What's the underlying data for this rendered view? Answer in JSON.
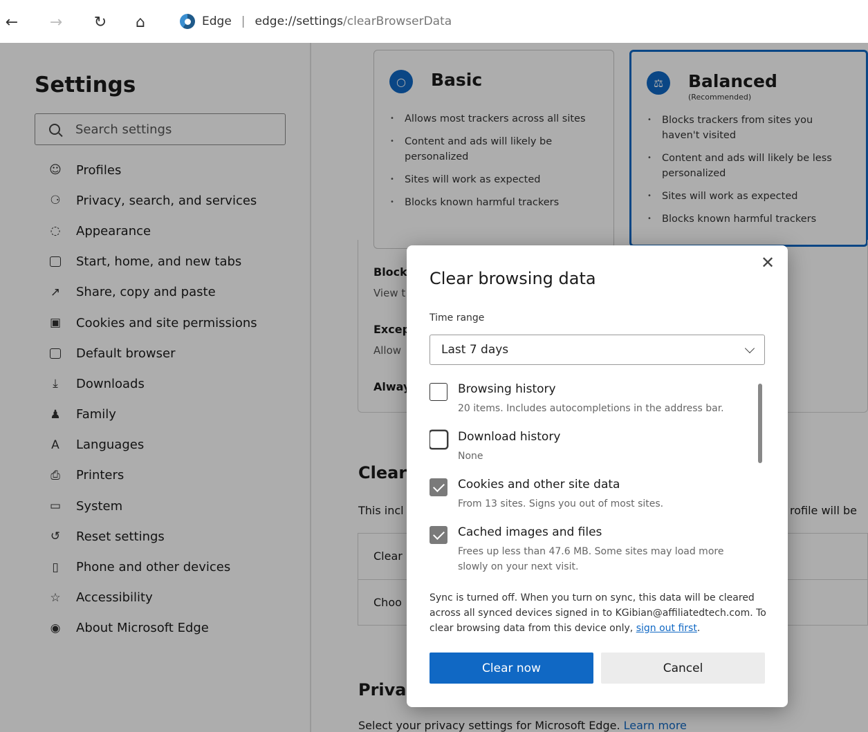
{
  "toolbar": {
    "site_label": "Edge",
    "url_host": "edge://settings",
    "url_path": "/clearBrowserData"
  },
  "sidebar": {
    "title": "Settings",
    "search_placeholder": "Search settings",
    "items": [
      {
        "label": "Profiles",
        "icon": "profile-icon"
      },
      {
        "label": "Privacy, search, and services",
        "icon": "lock-icon"
      },
      {
        "label": "Appearance",
        "icon": "palette-icon"
      },
      {
        "label": "Start, home, and new tabs",
        "icon": "home-tab-icon"
      },
      {
        "label": "Share, copy and paste",
        "icon": "share-icon"
      },
      {
        "label": "Cookies and site permissions",
        "icon": "cookies-icon"
      },
      {
        "label": "Default browser",
        "icon": "browser-icon"
      },
      {
        "label": "Downloads",
        "icon": "download-icon"
      },
      {
        "label": "Family",
        "icon": "family-icon"
      },
      {
        "label": "Languages",
        "icon": "language-icon"
      },
      {
        "label": "Printers",
        "icon": "printer-icon"
      },
      {
        "label": "System",
        "icon": "system-icon"
      },
      {
        "label": "Reset settings",
        "icon": "reset-icon"
      },
      {
        "label": "Phone and other devices",
        "icon": "phone-icon"
      },
      {
        "label": "Accessibility",
        "icon": "accessibility-icon"
      },
      {
        "label": "About Microsoft Edge",
        "icon": "edge-icon"
      }
    ]
  },
  "main": {
    "basic": {
      "title": "Basic",
      "bullets": [
        "Allows most trackers across all sites",
        "Content and ads will likely be personalized",
        "Sites will work as expected",
        "Blocks known harmful trackers"
      ]
    },
    "balanced": {
      "title": "Balanced",
      "subtitle": "(Recommended)",
      "bullets": [
        "Blocks trackers from sites you haven't visited",
        "Content and ads will likely be less personalized",
        "Sites will work as expected",
        "Blocks known harmful trackers"
      ]
    },
    "block_label": "Block",
    "view_label": "View t",
    "except_label": "Excep",
    "allow_label": "Allow",
    "always_label": "Alway",
    "clear_heading": "Clear",
    "clear_desc_left": "This incl",
    "clear_desc_right": "rofile will be",
    "clear_row": "Clear",
    "choose_row": "Choo",
    "privacy_heading": "Privac",
    "privacy_desc": "Select your privacy settings for Microsoft Edge.",
    "learn_more": "Learn more"
  },
  "dialog": {
    "title": "Clear browsing data",
    "time_range_label": "Time range",
    "time_range_value": "Last 7 days",
    "items": [
      {
        "title": "Browsing history",
        "desc": "20 items. Includes autocompletions in the address bar.",
        "checked": false
      },
      {
        "title": "Download history",
        "desc": "None",
        "checked": false
      },
      {
        "title": "Cookies and other site data",
        "desc": "From 13 sites. Signs you out of most sites.",
        "checked": true
      },
      {
        "title": "Cached images and files",
        "desc": "Frees up less than 47.6 MB. Some sites may load more slowly on your next visit.",
        "checked": true
      }
    ],
    "sync_text": "Sync is turned off. When you turn on sync, this data will be cleared across all synced devices signed in to KGibian@affiliatedtech.com. To clear browsing data from this device only,",
    "sign_out_link": "sign out first",
    "clear_button": "Clear now",
    "cancel_button": "Cancel"
  }
}
